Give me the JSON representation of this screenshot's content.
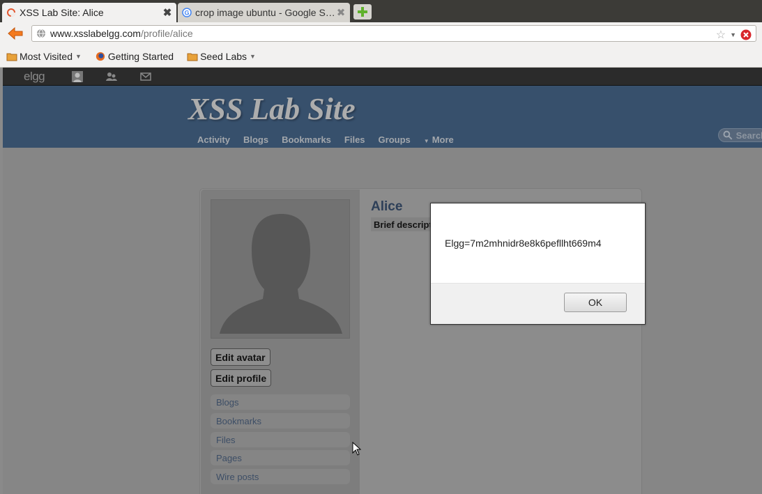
{
  "browser": {
    "tabs": [
      {
        "title": "XSS Lab Site: Alice",
        "active": true,
        "icon": "loading-ring-icon"
      },
      {
        "title": "crop image ubuntu - Google Search",
        "active": false,
        "icon": "google-icon"
      }
    ],
    "new_tab_icon": "plus-icon",
    "url": {
      "domain": "www.xsslabelgg.com",
      "path": "/profile/alice"
    },
    "bookmarks": [
      {
        "label": "Most Visited",
        "icon": "folder-icon",
        "dropdown": true
      },
      {
        "label": "Getting Started",
        "icon": "firefox-icon",
        "dropdown": false
      },
      {
        "label": "Seed Labs",
        "icon": "folder-icon",
        "dropdown": true
      }
    ]
  },
  "site": {
    "topbar_logo": "elgg",
    "title": "XSS Lab Site",
    "menu": [
      "Activity",
      "Blogs",
      "Bookmarks",
      "Files",
      "Groups"
    ],
    "more_label": "More",
    "search_placeholder": "Search"
  },
  "profile": {
    "name": "Alice",
    "brief_description": "Brief description",
    "buttons": {
      "edit_avatar": "Edit avatar",
      "edit_profile": "Edit profile"
    },
    "owner_menu": [
      "Blogs",
      "Bookmarks",
      "Files",
      "Pages",
      "Wire posts"
    ]
  },
  "alert": {
    "message": "Elgg=7m2mhnidr8e8k6pefllht669m4",
    "ok_label": "OK"
  },
  "colors": {
    "header_blue": "#37506c",
    "link_blue": "#3d4e66",
    "error_red": "#d8262b"
  }
}
